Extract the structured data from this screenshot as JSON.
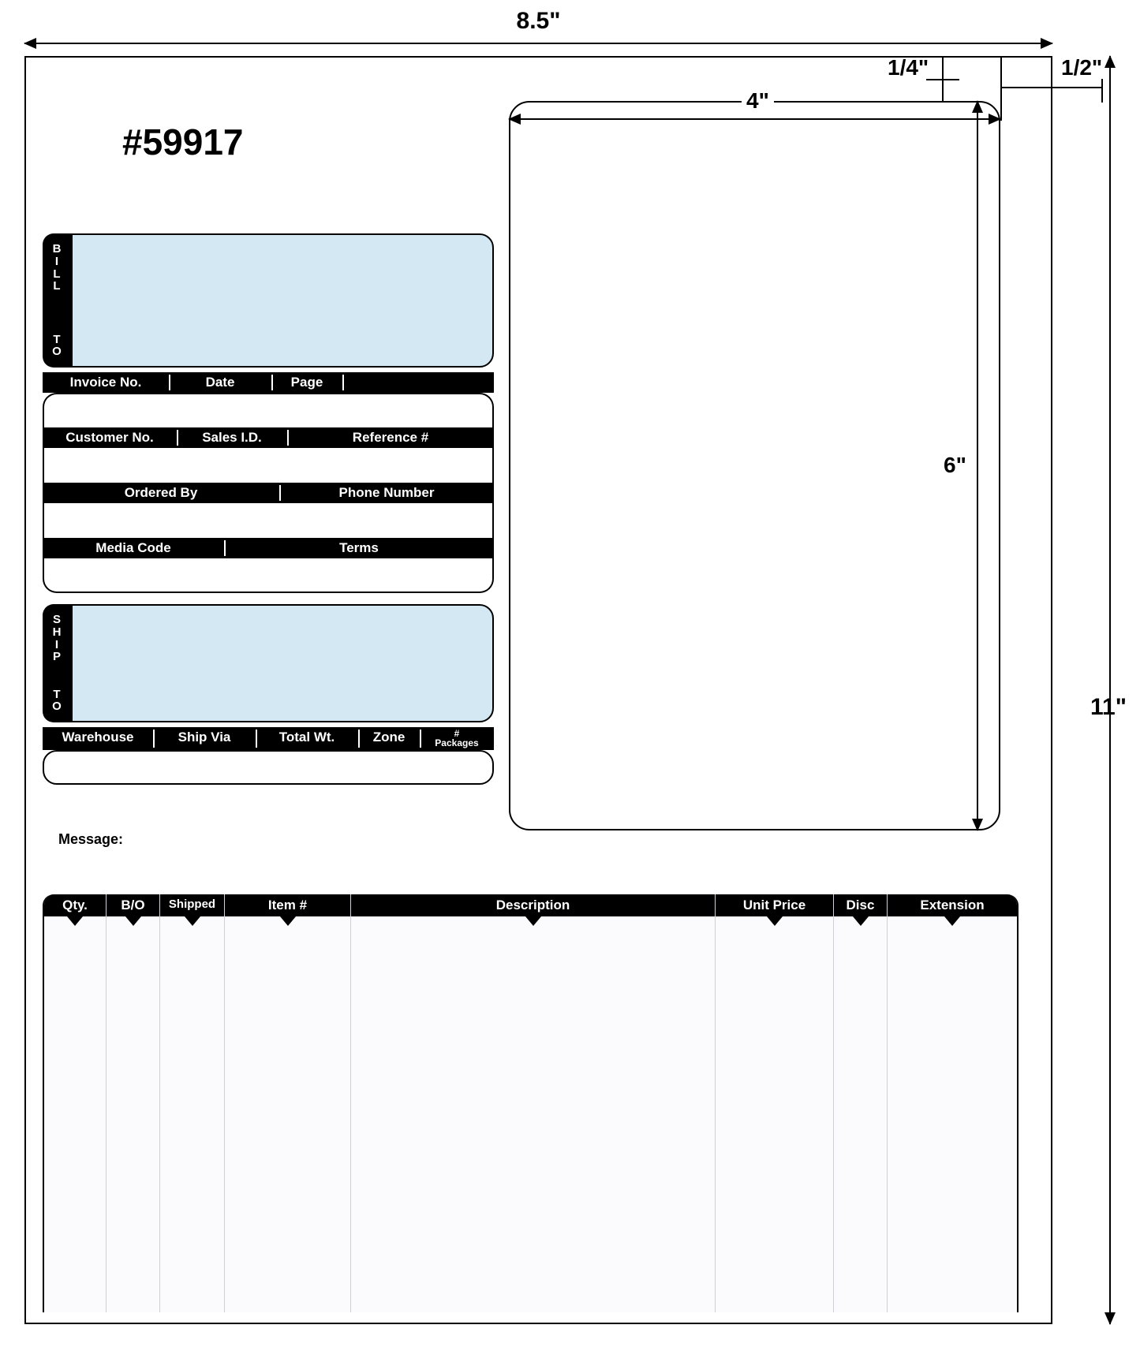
{
  "dimensions": {
    "width": "8.5\"",
    "height": "11\"",
    "label_width": "4\"",
    "label_height": "6\"",
    "top_margin": "1/4\"",
    "right_margin": "1/2\""
  },
  "form_number": "#59917",
  "bill_to": {
    "label_top": "BILL",
    "label_bottom": "TO"
  },
  "ship_to": {
    "label_top": "SHIP",
    "label_bottom": "TO"
  },
  "row1": {
    "invoice_no": "Invoice No.",
    "date": "Date",
    "page": "Page"
  },
  "row2": {
    "customer_no": "Customer No.",
    "sales_id": "Sales I.D.",
    "reference": "Reference #"
  },
  "row3": {
    "ordered_by": "Ordered By",
    "phone": "Phone Number"
  },
  "row4": {
    "media_code": "Media Code",
    "terms": "Terms"
  },
  "shiprow": {
    "warehouse": "Warehouse",
    "ship_via": "Ship Via",
    "total_wt": "Total Wt.",
    "zone": "Zone",
    "packages_top": "#",
    "packages_bottom": "Packages"
  },
  "message_label": "Message:",
  "items": {
    "qty": "Qty.",
    "bo": "B/O",
    "shipped": "Shipped",
    "item_no": "Item #",
    "description": "Description",
    "unit_price": "Unit Price",
    "disc": "Disc",
    "extension": "Extension"
  }
}
